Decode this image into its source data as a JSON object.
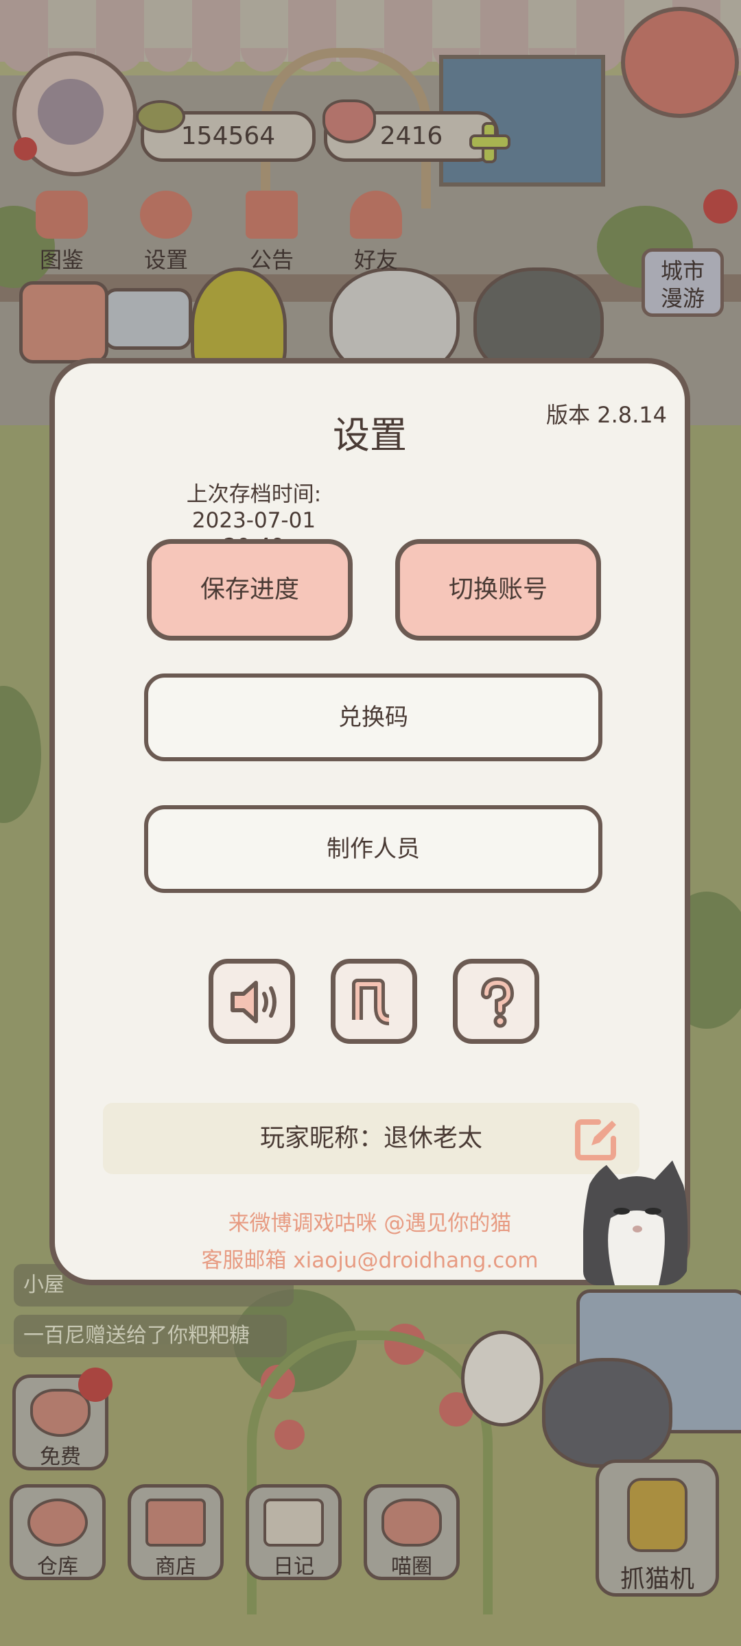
{
  "hud": {
    "coins": "154564",
    "hearts": "2416",
    "menu": [
      {
        "label": "图鉴",
        "icon": "cat-face-icon"
      },
      {
        "label": "设置",
        "icon": "gear-icon"
      },
      {
        "label": "公告",
        "icon": "gift-icon"
      },
      {
        "label": "好友",
        "icon": "friends-icon"
      }
    ],
    "city_travel": "城市漫游"
  },
  "settings": {
    "title": "设置",
    "version": "版本 2.8.14",
    "last_save_label": "上次存档时间:",
    "last_save_time": "2023-07-01 20:49",
    "save_button": "保存进度",
    "switch_account_button": "切换账号",
    "redeem_button": "兑换码",
    "credits_button": "制作人员",
    "icon_buttons": [
      "sound-icon",
      "music-note-icon",
      "help-icon"
    ],
    "nickname": "玩家昵称：退休老太",
    "weibo_line": "来微博调戏咕咪 @遇见你的猫",
    "email_line": "客服邮箱 xiaoju@droidhang.com"
  },
  "toasts": {
    "line1": "小屋",
    "line2": "一百尼赠送给了你粑粑糖"
  },
  "bottom_bar": {
    "free": "免费",
    "warehouse": "仓库",
    "shop": "商店",
    "diary": "日记",
    "meow_circle": "喵圈",
    "claw_machine": "抓猫机"
  },
  "colors": {
    "dialog_bg": "#f4f2ec",
    "border": "#6b5a52",
    "pink_button": "#f6c6ba",
    "footer_text": "#e79b82",
    "overlay_scene": "#9a9a72"
  }
}
